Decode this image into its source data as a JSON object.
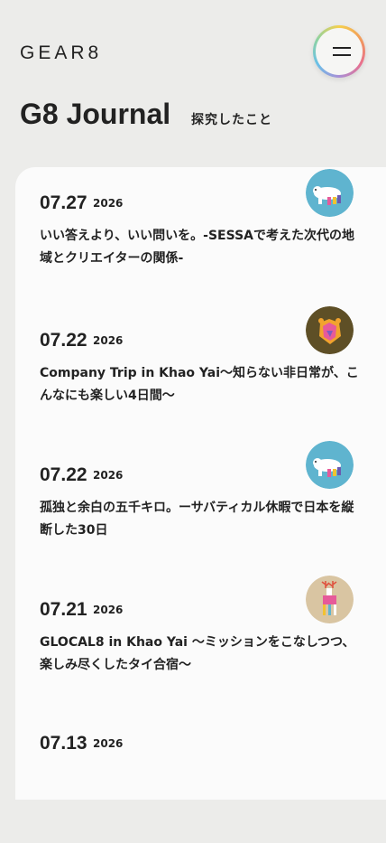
{
  "header": {
    "logo": "GEAR8",
    "menu_icon": "hamburger-menu-icon"
  },
  "page": {
    "title": "G8 Journal",
    "subtitle": "探究したこと"
  },
  "colors": {
    "background": "#ececea",
    "card": "#fbfbfb",
    "text": "#222222",
    "thumb_blue": "#5fb4cf",
    "thumb_brown": "#5e4f26",
    "thumb_beige": "#d9c5a2"
  },
  "entries": [
    {
      "date": "07.27",
      "year": "2026",
      "title": "いい答えより、いい問いを。-SESSAで考えた次代の地域とクリエイターの関係-",
      "thumb": "polar-bear-icon"
    },
    {
      "date": "07.22",
      "year": "2026",
      "title": "Company Trip in Khao Yai〜知らない非日常が、こんなにも楽しい4日間〜",
      "thumb": "bear-face-icon"
    },
    {
      "date": "07.22",
      "year": "2026",
      "title": "孤独と余白の五千キロ。ーサバティカル休暇で日本を縦断した30日",
      "thumb": "polar-bear-icon"
    },
    {
      "date": "07.21",
      "year": "2026",
      "title": "GLOCAL8 in Khao Yai 〜ミッションをこなしつつ、楽しみ尽くしたタイ合宿〜",
      "thumb": "deer-icon"
    },
    {
      "date": "07.13",
      "year": "2026",
      "title": "",
      "thumb": ""
    }
  ]
}
